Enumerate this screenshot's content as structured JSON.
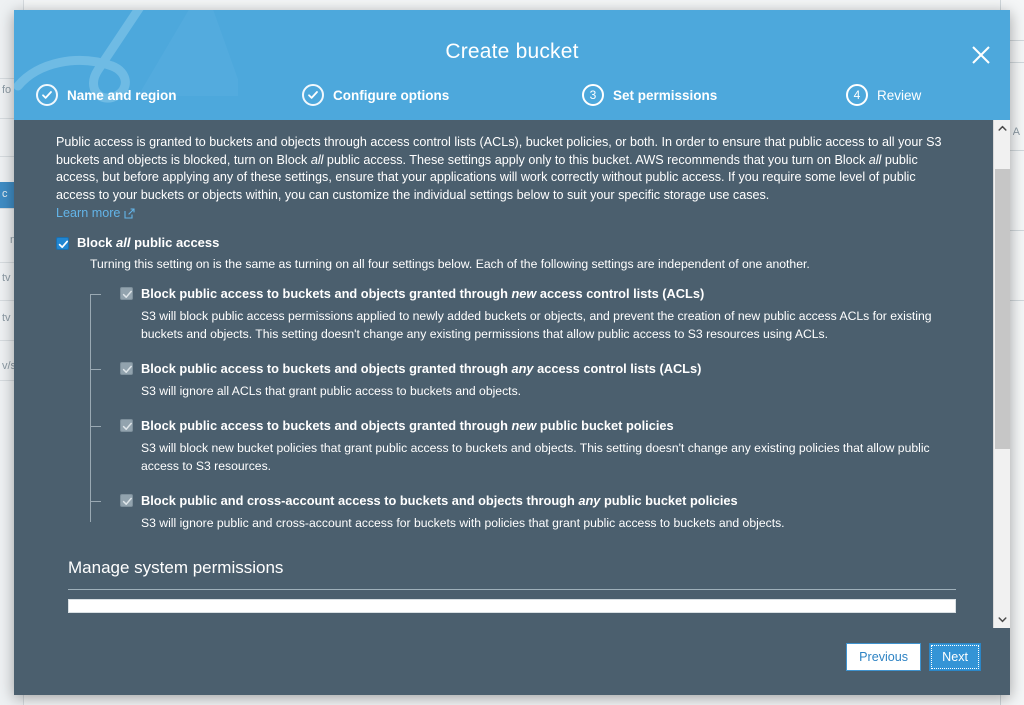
{
  "background": {
    "ghost_labels": [
      "fo",
      "c",
      "n",
      "tv",
      "tv",
      "v/s"
    ],
    "right_label": "A"
  },
  "modal": {
    "title": "Create bucket",
    "close_icon": "close-icon",
    "steps": [
      {
        "label": "Name and region",
        "badge": "✓",
        "state": "done"
      },
      {
        "label": "Configure options",
        "badge": "✓",
        "state": "done"
      },
      {
        "label": "Set permissions",
        "badge": "3",
        "state": "current"
      },
      {
        "label": "Review",
        "badge": "4",
        "state": "upcoming"
      }
    ],
    "intro": {
      "part1": "Public access is granted to buckets and objects through access control lists (ACLs), bucket policies, or both. In order to ensure that public access to all your S3 buckets and objects is blocked, turn on Block ",
      "em1": "all",
      "part2": " public access. These settings apply only to this bucket. AWS recommends that you turn on Block ",
      "em2": "all",
      "part3": " public access, but before applying any of these settings, ensure that your applications will work correctly without public access. If you require some level of public access to your buckets or objects within, you can customize the individual settings below to suit your specific storage use cases.",
      "learn_more": "Learn more",
      "learn_more_icon": "external-link-icon"
    },
    "master_setting": {
      "checked": true,
      "label_part1": "Block ",
      "label_em": "all",
      "label_part2": " public access",
      "description": "Turning this setting on is the same as turning on all four settings below. Each of the following settings are independent of one another."
    },
    "sub_settings": [
      {
        "checked": true,
        "disabled": true,
        "title_part1": "Block public access to buckets and objects granted through ",
        "title_em": "new",
        "title_part2": " access control lists (ACLs)",
        "description": "S3 will block public access permissions applied to newly added buckets or objects, and prevent the creation of new public access ACLs for existing buckets and objects. This setting doesn't change any existing permissions that allow public access to S3 resources using ACLs."
      },
      {
        "checked": true,
        "disabled": true,
        "title_part1": "Block public access to buckets and objects granted through ",
        "title_em": "any",
        "title_part2": " access control lists (ACLs)",
        "description": "S3 will ignore all ACLs that grant public access to buckets and objects."
      },
      {
        "checked": true,
        "disabled": true,
        "title_part1": "Block public access to buckets and objects granted through ",
        "title_em": "new",
        "title_part2": " public bucket policies",
        "description": "S3 will block new bucket policies that grant public access to buckets and objects. This setting doesn't change any existing policies that allow public access to S3 resources."
      },
      {
        "checked": true,
        "disabled": true,
        "title_part1": "Block public and cross-account access to buckets and objects through ",
        "title_em": "any",
        "title_part2": " public bucket policies",
        "description": "S3 will ignore public and cross-account access for buckets with policies that grant public access to buckets and objects."
      }
    ],
    "section_heading": "Manage system permissions",
    "footer": {
      "previous_label": "Previous",
      "next_label": "Next"
    },
    "scrollbar": {
      "up_icon": "chevron-up-icon",
      "down_icon": "chevron-down-icon"
    }
  },
  "colors": {
    "header_blue": "#4da8dc",
    "body_slate": "#4b5f6e",
    "link_blue": "#63b4e8",
    "checkbox_blue": "#2186d1",
    "next_button_blue": "#3494d6",
    "previous_text_blue": "#2d83c4"
  }
}
